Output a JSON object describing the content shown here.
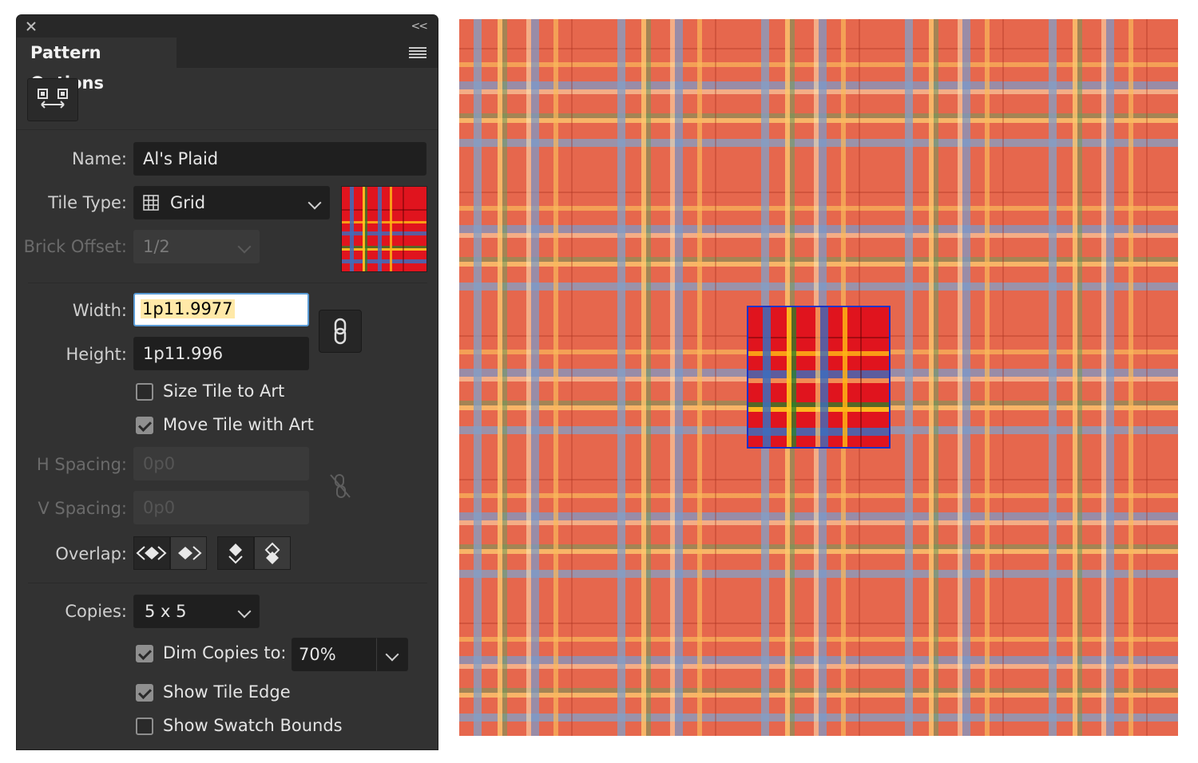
{
  "panel": {
    "title": "Pattern Options",
    "collapse_glyph": "<<",
    "icons": {
      "close": "close-icon",
      "collapse": "double-chevron-left-icon",
      "menu": "panel-menu-icon",
      "tile_tool": "pattern-tile-tool-icon"
    }
  },
  "fields": {
    "name_label": "Name:",
    "name_value": "Al's Plaid",
    "tile_type_label": "Tile Type:",
    "tile_type_value": "Grid",
    "brick_offset_label": "Brick Offset:",
    "brick_offset_value": "1/2",
    "width_label": "Width:",
    "width_value": "1p11.9977",
    "height_label": "Height:",
    "height_value": "1p11.996",
    "h_spacing_label": "H Spacing:",
    "h_spacing_value": "0p0",
    "v_spacing_label": "V Spacing:",
    "v_spacing_value": "0p0",
    "overlap_label": "Overlap:",
    "copies_label": "Copies:",
    "copies_value": "5 x 5",
    "dim_copies_value": "70%"
  },
  "checkboxes": {
    "size_tile_to_art": {
      "label": "Size Tile to Art",
      "checked": false
    },
    "move_tile_with_art": {
      "label": "Move Tile with Art",
      "checked": true
    },
    "dim_copies": {
      "label": "Dim Copies to:",
      "checked": true
    },
    "show_tile_edge": {
      "label": "Show Tile Edge",
      "checked": true
    },
    "show_swatch_bounds": {
      "label": "Show Swatch Bounds",
      "checked": false
    }
  },
  "colors": {
    "panel_bg": "#323232",
    "plaid_base": "#e6674d",
    "tile_base": "#e0141e",
    "tile_edge": "#1733c8",
    "focus_ring": "#5a9bd5"
  }
}
